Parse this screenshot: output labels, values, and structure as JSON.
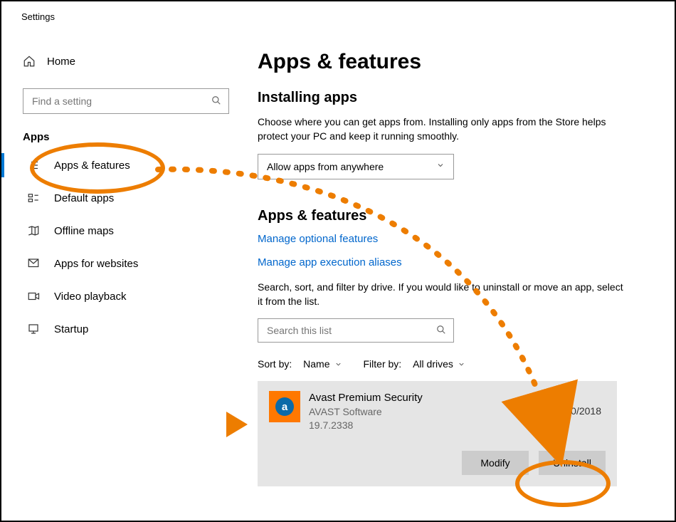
{
  "window": {
    "title": "Settings"
  },
  "sidebar": {
    "home": "Home",
    "search_placeholder": "Find a setting",
    "section": "Apps",
    "items": [
      {
        "label": "Apps & features",
        "active": true
      },
      {
        "label": "Default apps"
      },
      {
        "label": "Offline maps"
      },
      {
        "label": "Apps for websites"
      },
      {
        "label": "Video playback"
      },
      {
        "label": "Startup"
      }
    ]
  },
  "main": {
    "title": "Apps & features",
    "installing": {
      "heading": "Installing apps",
      "desc": "Choose where you can get apps from. Installing only apps from the Store helps protect your PC and keep it running smoothly.",
      "dropdown_value": "Allow apps from anywhere"
    },
    "apps": {
      "heading": "Apps & features",
      "link_optional": "Manage optional features",
      "link_aliases": "Manage app execution aliases",
      "desc": "Search, sort, and filter by drive. If you would like to uninstall or move an app, select it from the list.",
      "search_placeholder": "Search this list",
      "sort_label": "Sort by:",
      "sort_value": "Name",
      "filter_label": "Filter by:",
      "filter_value": "All drives"
    },
    "selected_app": {
      "name": "Avast Premium Security",
      "publisher": "AVAST Software",
      "version": "19.7.2338",
      "date": "0/2018",
      "modify": "Modify",
      "uninstall": "Uninstall"
    }
  },
  "annotations": {
    "color": "#ed7d00"
  }
}
